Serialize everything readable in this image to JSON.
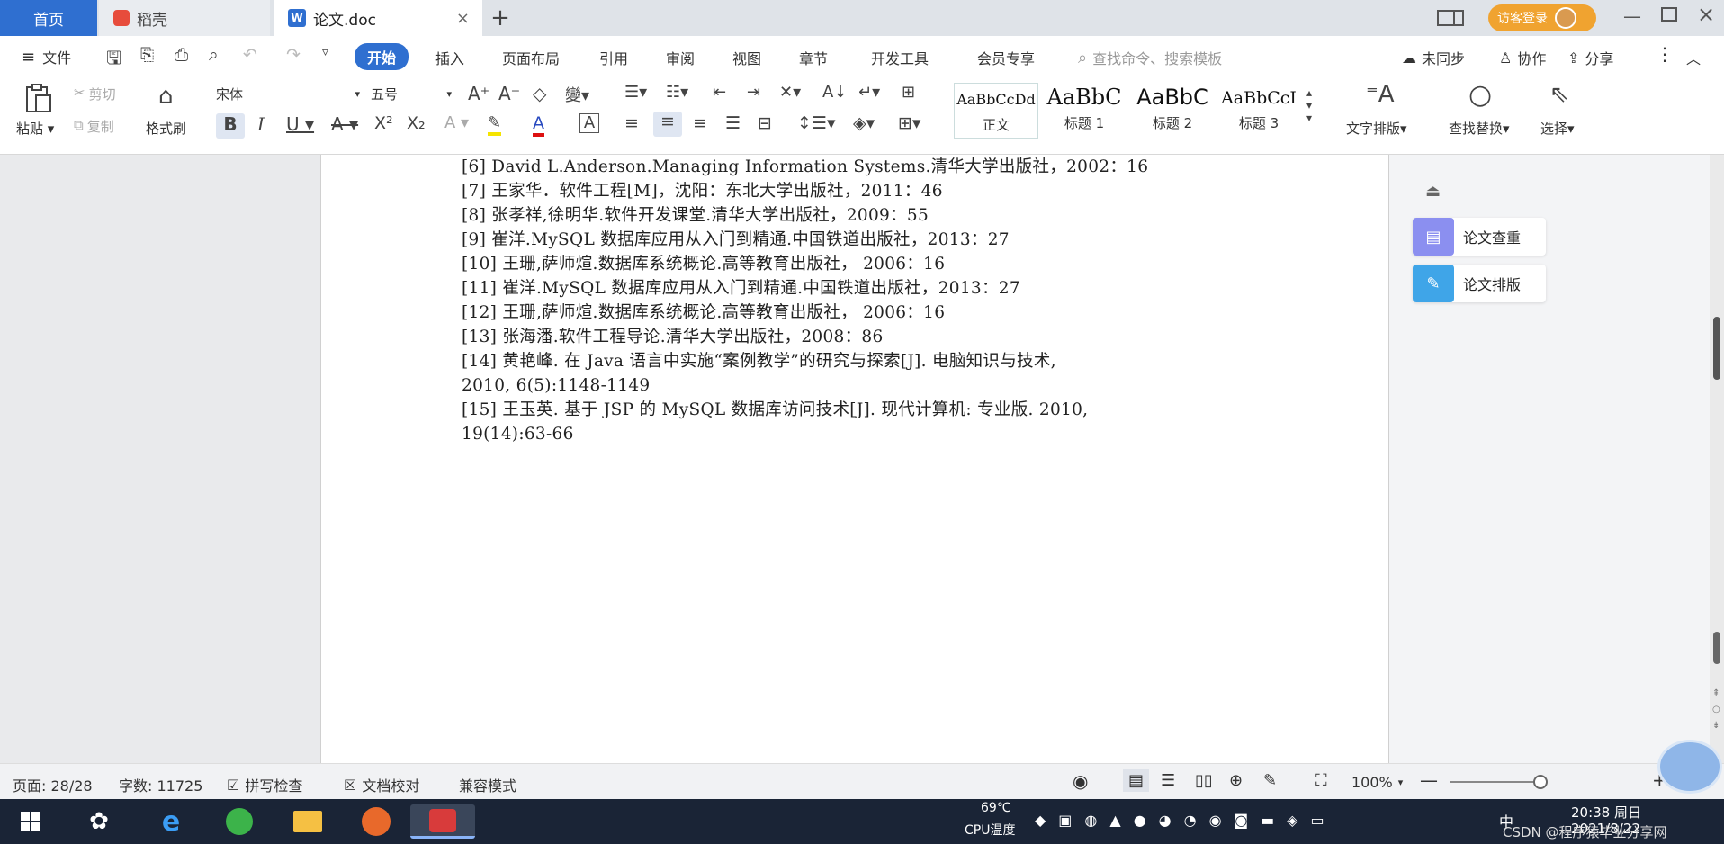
{
  "tabs": {
    "home": "首页",
    "daoke": "稻壳",
    "doc": "论文.doc",
    "new_tab": "+"
  },
  "titlebar": {
    "visitor": "访客登录"
  },
  "menu": {
    "file": "文件",
    "items": [
      "开始",
      "插入",
      "页面布局",
      "引用",
      "审阅",
      "视图",
      "章节",
      "开发工具",
      "会员专享"
    ],
    "search_placeholder": "查找命令、搜索模板",
    "sync": "未同步",
    "collab": "协作",
    "share": "分享"
  },
  "ribbon": {
    "paste": "粘贴",
    "cut": "剪切",
    "copy": "复制",
    "format_painter": "格式刷",
    "font_name": "宋体",
    "font_size": "五号",
    "styles": [
      {
        "preview": "AaBbCcDd",
        "name": "正文"
      },
      {
        "preview": "AaBbC",
        "name": "标题 1"
      },
      {
        "preview": "AaBbC",
        "name": "标题 2"
      },
      {
        "preview": "AaBbCcI",
        "name": "标题 3"
      }
    ],
    "text_layout": "文字排版",
    "find_replace": "查找替换",
    "select": "选择"
  },
  "document": {
    "lines": [
      "[6] David L.Anderson.Managing  Information Systems.清华大学出版社，2002：16",
      "[7] 王家华．软件工程[M]，沈阳：东北大学出版社，2011：46",
      "[8] 张孝祥,徐明华.软件开发课堂.清华大学出版社，2009：55",
      "[9] 崔洋.MySQL 数据库应用从入门到精通.中国铁道出版社，2013：27",
      "[10] 王珊,萨师煊.数据库系统概论.高等教育出版社， 2006：16",
      "[11] 崔洋.MySQL 数据库应用从入门到精通.中国铁道出版社，2013：27",
      "[12] 王珊,萨师煊.数据库系统概论.高等教育出版社， 2006：16",
      "[13] 张海潘.软件工程导论.清华大学出版社，2008：86",
      "[14] 黄艳峰. 在 Java 语言中实施“案例教学”的研究与探索[J]. 电脑知识与技术,",
      "2010, 6(5):1148-1149",
      "[15] 王玉英. 基于 JSP 的 MySQL 数据库访问技术[J]. 现代计算机: 专业版. 2010,",
      "19(14):63-66"
    ]
  },
  "side_panel": {
    "check": "论文查重",
    "layout": "论文排版"
  },
  "status": {
    "page": "页面: 28/28",
    "words": "字数: 11725",
    "spell": "拼写检查",
    "proof": "文档校对",
    "compat": "兼容模式",
    "zoom": "100%"
  },
  "taskbar": {
    "temp": "69℃",
    "cpu": "CPU温度",
    "time": "20:38 周日",
    "date": "2021/8/22",
    "ime": "中",
    "watermark": "CSDN @程序猿毕业分享网"
  },
  "colors": {
    "accent": "#2f6fd0",
    "taskbar": "#1a2436"
  }
}
